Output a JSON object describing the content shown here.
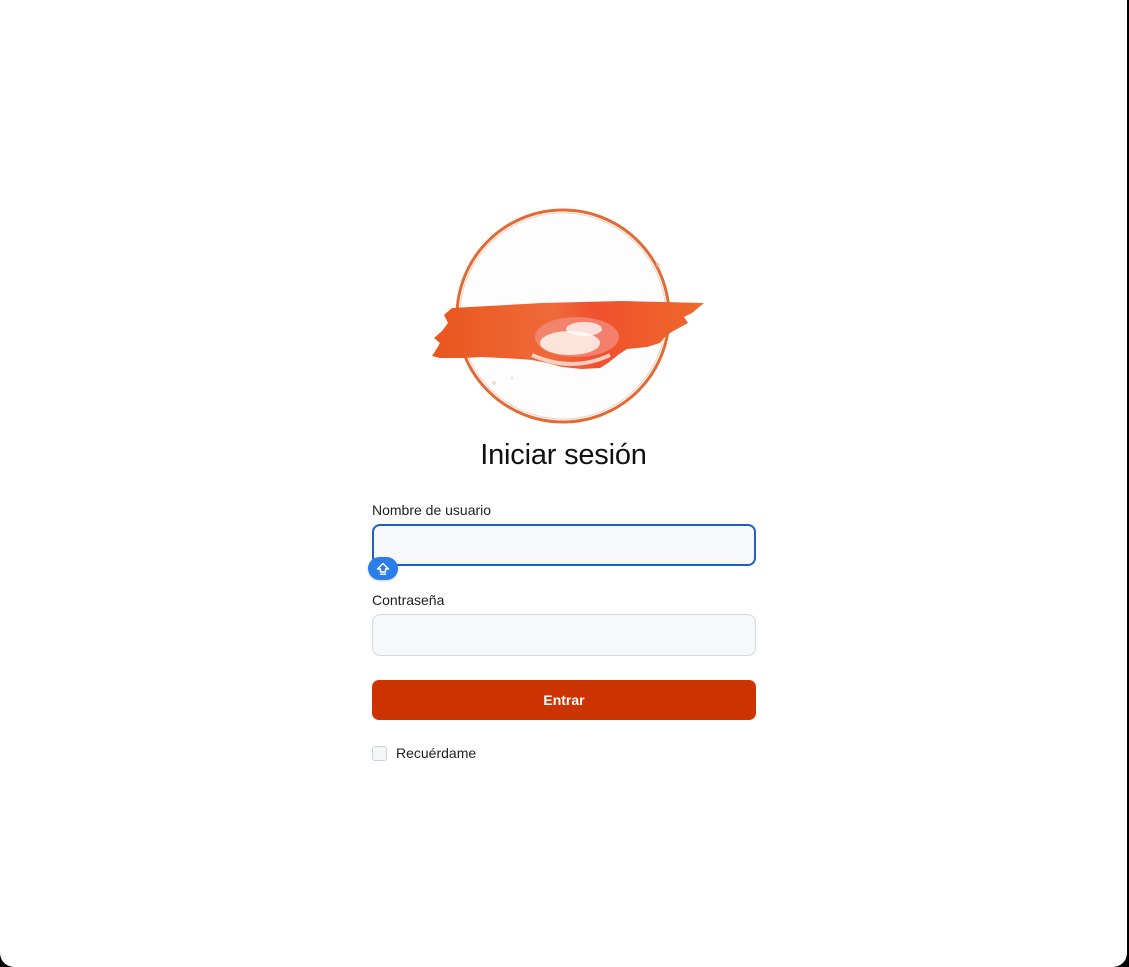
{
  "login": {
    "title": "Iniciar sesión",
    "username_label": "Nombre de usuario",
    "username_value": "",
    "password_label": "Contraseña",
    "password_value": "",
    "submit_label": "Entrar",
    "remember_label": "Recuérdame",
    "remember_checked": false
  },
  "icons": {
    "password_manager": "key-up-arrow-icon",
    "logo": "orange-brushstroke-circle-logo"
  },
  "colors": {
    "accent": "#cc3404",
    "focus_border": "#1f5fbf",
    "password_manager_badge": "#2b7de9",
    "logo_orange": "#e8622a"
  }
}
